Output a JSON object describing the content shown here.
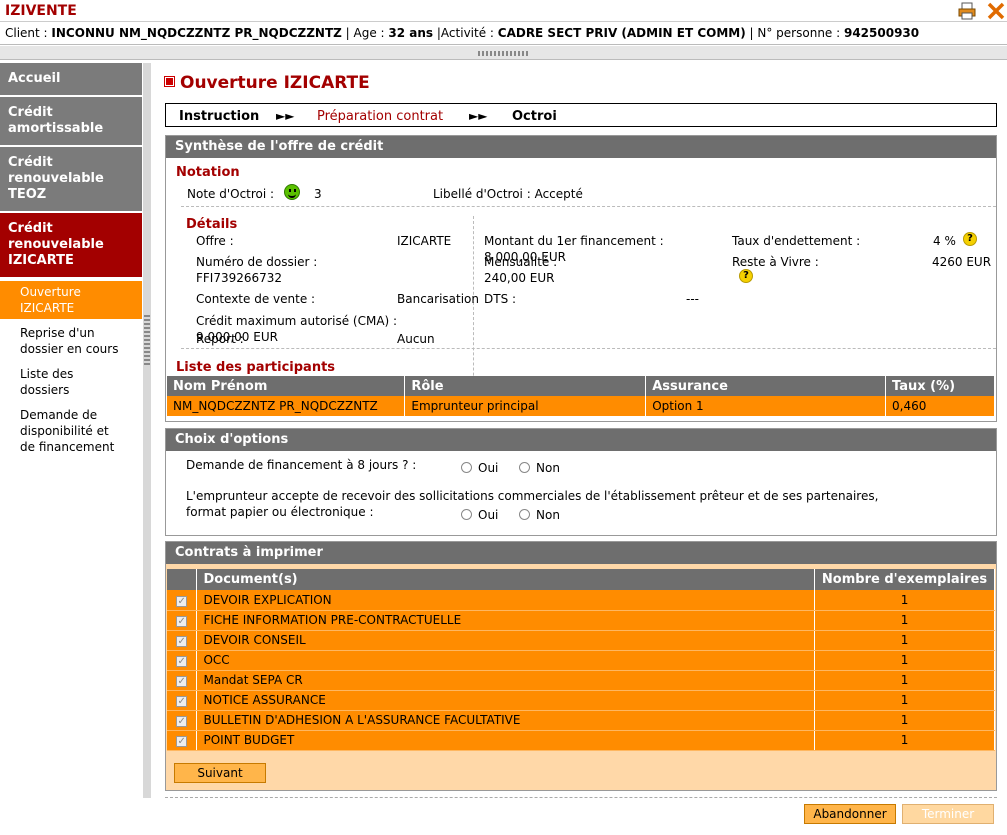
{
  "app": {
    "title": "IZIVENTE"
  },
  "client": {
    "client_label": "Client : ",
    "client_name": "INCONNU NM_NQDCZZNTZ PR_NQDCZZNTZ",
    "age_label": " | Age : ",
    "age_value": "32 ans",
    "activity_label": " |Activité : ",
    "activity_value": "CADRE SECT PRIV (ADMIN ET COMM)",
    "person_label": " | N° personne : ",
    "person_value": "942500930"
  },
  "sidebar": {
    "items": [
      {
        "label": "Accueil"
      },
      {
        "label": "Crédit amortissable"
      },
      {
        "label": "Crédit renouvelable TEOZ"
      },
      {
        "label": "Crédit renouvelable IZICARTE"
      }
    ],
    "subitems": [
      {
        "label": "Ouverture IZICARTE"
      },
      {
        "label": "Reprise d'un dossier en cours"
      },
      {
        "label": "Liste des dossiers"
      },
      {
        "label": "Demande de disponibilité et de financement"
      }
    ]
  },
  "page": {
    "title": "Ouverture IZICARTE"
  },
  "steps": [
    "Instruction",
    "Préparation contrat",
    "Octroi"
  ],
  "synthese": {
    "title": "Synthèse de l'offre de crédit",
    "notation_title": "Notation",
    "note_label": "Note d'Octroi :",
    "note_value": "3",
    "libelle_label": "Libellé d'Octroi : Accepté",
    "details_title": "Détails",
    "offre_label": "Offre :",
    "offre_value": "IZICARTE",
    "dossier_label": "Numéro de dossier :",
    "dossier_value": "FFI739266732",
    "contexte_label": "Contexte de vente :",
    "contexte_value": "Bancarisation",
    "cma_label": "Crédit maximum autorisé (CMA) :",
    "cma_value": "9 000,00 EUR",
    "report_label": "Report :",
    "report_value": "Aucun",
    "montant_label": "Montant du 1er financement :",
    "montant_value": "8 000,00 EUR",
    "mensualite_label": "Mensualité :",
    "mensualite_value": "240,00 EUR",
    "dts_label": "DTS :",
    "dts_value": "---",
    "taux_label": "Taux d'endettement :",
    "taux_value": "4 %",
    "reste_label": "Reste à Vivre :",
    "reste_value": "4260 EUR",
    "participants_title": "Liste des participants",
    "participants_headers": [
      "Nom Prénom",
      "Rôle",
      "Assurance",
      "Taux (%)"
    ],
    "participants_rows": [
      [
        "NM_NQDCZZNTZ PR_NQDCZZNTZ",
        "Emprunteur principal",
        "Option 1",
        "0,460"
      ]
    ]
  },
  "options": {
    "title": "Choix d'options",
    "q1": "Demande de financement à 8 jours ? :",
    "q2_line1": "L'emprunteur accepte de recevoir des sollicitations commerciales de l'établissement prêteur et de ses partenaires,",
    "q2_line2": "format papier ou électronique :",
    "oui": "Oui",
    "non": "Non"
  },
  "contrats": {
    "title": "Contrats à imprimer",
    "col_doc": "Document(s)",
    "col_nb": "Nombre d'exemplaires",
    "rows": [
      {
        "doc": "DEVOIR EXPLICATION",
        "nb": "1"
      },
      {
        "doc": "FICHE INFORMATION PRE-CONTRACTUELLE",
        "nb": "1"
      },
      {
        "doc": "DEVOIR CONSEIL",
        "nb": "1"
      },
      {
        "doc": "OCC",
        "nb": "1"
      },
      {
        "doc": "Mandat SEPA CR",
        "nb": "1"
      },
      {
        "doc": "NOTICE ASSURANCE",
        "nb": "1"
      },
      {
        "doc": "BULLETIN D'ADHESION A L'ASSURANCE FACULTATIVE",
        "nb": "1"
      },
      {
        "doc": "POINT BUDGET",
        "nb": "1"
      }
    ],
    "suivant": "Suivant"
  },
  "footer": {
    "abandonner": "Abandonner",
    "terminer": "Terminer"
  },
  "icons": {
    "help": "?",
    "checkbox": "✓"
  },
  "colors": {
    "brand_red": "#a30000",
    "accent_orange": "#ff8c00",
    "header_gray": "#6e6e6e"
  }
}
